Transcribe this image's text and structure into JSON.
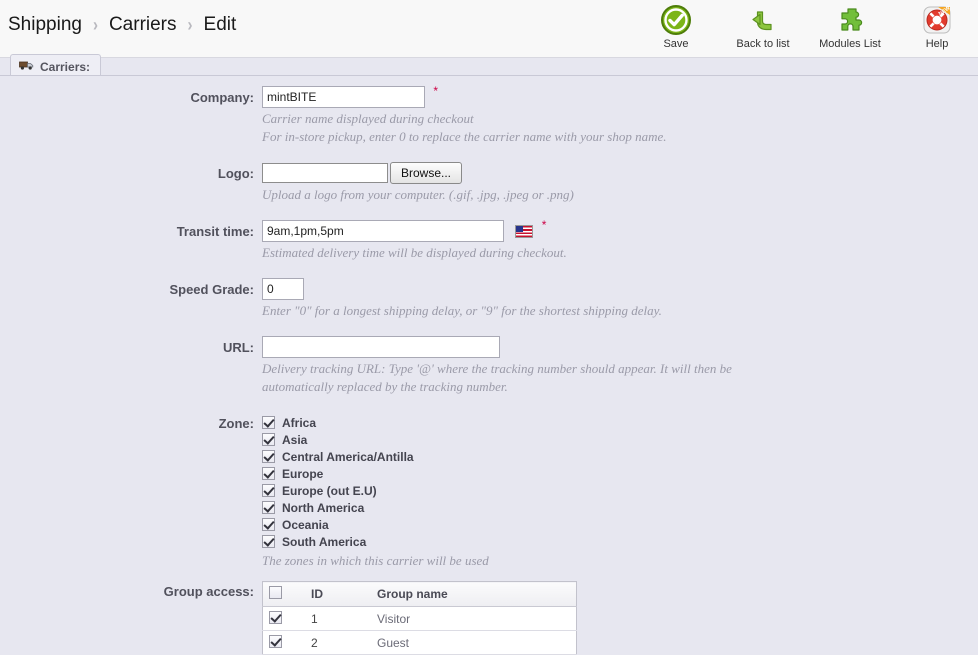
{
  "breadcrumb": {
    "items": [
      "Shipping",
      "Carriers",
      "Edit"
    ],
    "separator": "›"
  },
  "toolbar": {
    "buttons": [
      {
        "label": "Save",
        "icon": "check-circle-icon"
      },
      {
        "label": "Back to list",
        "icon": "back-arrow-icon"
      },
      {
        "label": "Modules List",
        "icon": "puzzle-piece-icon"
      },
      {
        "label": "Help",
        "icon": "life-ring-icon",
        "badge": "NEW"
      }
    ]
  },
  "tab": {
    "label": "Carriers:",
    "icon": "truck-icon"
  },
  "form": {
    "company": {
      "label": "Company:",
      "value": "mintBITE",
      "placeholder": "",
      "required": true,
      "hints": [
        "Carrier name displayed during checkout",
        "For in-store pickup, enter 0 to replace the carrier name with your shop name."
      ]
    },
    "logo": {
      "label": "Logo:",
      "value": "",
      "browse_label": "Browse...",
      "hint": "Upload a logo from your computer. (.gif, .jpg, .jpeg or .png)"
    },
    "transit_time": {
      "label": "Transit time:",
      "value": "9am,1pm,5pm",
      "required": true,
      "flag": "us-flag-icon",
      "hint": "Estimated delivery time will be displayed during checkout."
    },
    "speed_grade": {
      "label": "Speed Grade:",
      "value": "0",
      "hint": "Enter \"0\" for a longest shipping delay, or \"9\" for the shortest shipping delay."
    },
    "url": {
      "label": "URL:",
      "value": "",
      "hints": [
        "Delivery tracking URL: Type '@' where the tracking number should appear. It will then be",
        "automatically replaced by the tracking number."
      ]
    },
    "zone": {
      "label": "Zone:",
      "hint": "The zones in which this carrier will be used",
      "items": [
        {
          "label": "Africa",
          "checked": true
        },
        {
          "label": "Asia",
          "checked": true
        },
        {
          "label": "Central America/Antilla",
          "checked": true
        },
        {
          "label": "Europe",
          "checked": true
        },
        {
          "label": "Europe (out E.U)",
          "checked": true
        },
        {
          "label": "North America",
          "checked": true
        },
        {
          "label": "Oceania",
          "checked": true
        },
        {
          "label": "South America",
          "checked": true
        }
      ]
    },
    "group_access": {
      "label": "Group access:",
      "columns": [
        "",
        "ID",
        "Group name"
      ],
      "select_all_checked": false,
      "rows": [
        {
          "checked": true,
          "id": "1",
          "name": "Visitor"
        },
        {
          "checked": true,
          "id": "2",
          "name": "Guest"
        }
      ]
    }
  },
  "colors": {
    "page_bg": "#e7e7f0",
    "header_bg": "#f8f8f8",
    "label_text": "#51515c",
    "hint_text": "#9a9aa8",
    "required_star": "#cc0044",
    "save_green": "#6ab023",
    "help_red": "#e23b2e"
  }
}
